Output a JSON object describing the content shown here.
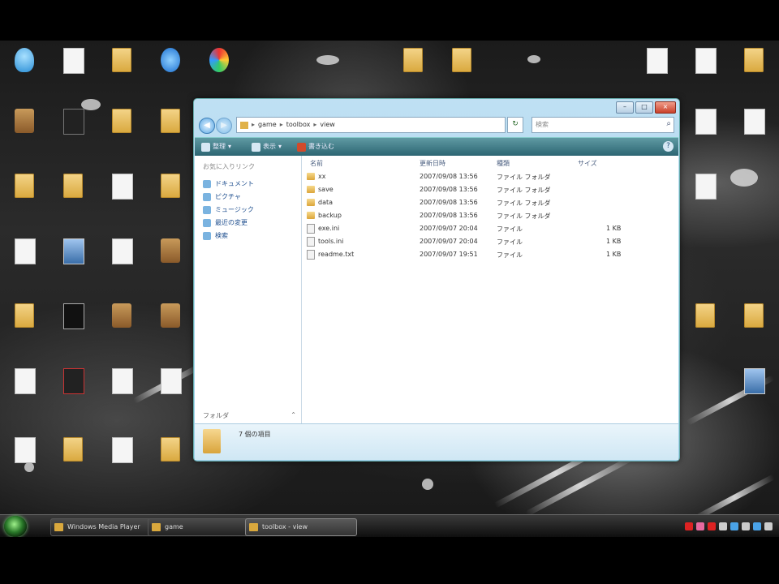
{
  "desktop": {
    "icons": [
      {
        "type": "user",
        "label": ""
      },
      {
        "type": "doc",
        "label": ""
      },
      {
        "type": "folder",
        "label": ""
      },
      {
        "type": "ie",
        "label": ""
      },
      {
        "type": "color",
        "label": ""
      },
      {
        "type": "box",
        "label": ""
      },
      {
        "type": "rss",
        "label": ""
      },
      {
        "type": "folder",
        "label": ""
      },
      {
        "type": "folder",
        "label": ""
      },
      {
        "type": "folder",
        "label": ""
      },
      {
        "type": "folder",
        "label": ""
      },
      {
        "type": "doc",
        "label": ""
      },
      {
        "type": "folder",
        "label": ""
      },
      {
        "type": "doc",
        "label": ""
      },
      {
        "type": "pic",
        "label": ""
      },
      {
        "type": "doc",
        "label": ""
      },
      {
        "type": "box",
        "label": ""
      },
      {
        "type": "folder",
        "label": ""
      },
      {
        "type": "dark",
        "label": ""
      },
      {
        "type": "box",
        "label": ""
      },
      {
        "type": "box",
        "label": ""
      },
      {
        "type": "doc",
        "label": ""
      },
      {
        "type": "red",
        "label": ""
      },
      {
        "type": "doc",
        "label": ""
      },
      {
        "type": "doc",
        "label": ""
      },
      {
        "type": "doc",
        "label": ""
      },
      {
        "type": "folder",
        "label": ""
      },
      {
        "type": "doc",
        "label": ""
      },
      {
        "type": "folder",
        "label": ""
      },
      {
        "type": "folder",
        "label": ""
      },
      {
        "type": "folder",
        "label": ""
      },
      {
        "type": "doc",
        "label": ""
      },
      {
        "type": "doc",
        "label": ""
      },
      {
        "type": "folder",
        "label": ""
      },
      {
        "type": "doc",
        "label": ""
      },
      {
        "type": "doc",
        "label": ""
      },
      {
        "type": "doc",
        "label": ""
      },
      {
        "type": "folder",
        "label": ""
      },
      {
        "type": "folder",
        "label": ""
      },
      {
        "type": "pic",
        "label": ""
      }
    ]
  },
  "window": {
    "title_buttons": {
      "minimize": "–",
      "maximize": "□",
      "close": "×"
    },
    "nav": {
      "back": "◀",
      "forward": "▶"
    },
    "address": {
      "crumbs": [
        "game",
        "toolbox",
        "view"
      ]
    },
    "search": {
      "placeholder": "検索"
    },
    "command_bar": {
      "organize": "整理",
      "views": "表示",
      "burn": "書き込む"
    },
    "nav_pane": {
      "header": "お気に入りリンク",
      "favorites": [
        "ドキュメント",
        "ピクチャ",
        "ミュージック",
        "最近の変更",
        "検索"
      ],
      "folders_label": "フォルダ"
    },
    "columns": {
      "name": "名前",
      "date": "更新日時",
      "type": "種類",
      "size": "サイズ"
    },
    "files": [
      {
        "kind": "folder",
        "name": "xx",
        "date": "2007/09/08 13:56",
        "type": "ファイル フォルダ",
        "size": ""
      },
      {
        "kind": "folder",
        "name": "save",
        "date": "2007/09/08 13:56",
        "type": "ファイル フォルダ",
        "size": ""
      },
      {
        "kind": "folder",
        "name": "data",
        "date": "2007/09/08 13:56",
        "type": "ファイル フォルダ",
        "size": ""
      },
      {
        "kind": "folder",
        "name": "backup",
        "date": "2007/09/08 13:56",
        "type": "ファイル フォルダ",
        "size": ""
      },
      {
        "kind": "file",
        "name": "exe.ini",
        "date": "2007/09/07 20:04",
        "type": "ファイル",
        "size": "1 KB"
      },
      {
        "kind": "file",
        "name": "tools.ini",
        "date": "2007/09/07 20:04",
        "type": "ファイル",
        "size": "1 KB"
      },
      {
        "kind": "file",
        "name": "readme.txt",
        "date": "2007/09/07 19:51",
        "type": "ファイル",
        "size": "1 KB"
      }
    ],
    "details": {
      "text": "7 個の項目"
    }
  },
  "taskbar": {
    "tasks": [
      {
        "label": "Windows Media Player"
      },
      {
        "label": "game"
      },
      {
        "label": "toolbox - view"
      }
    ],
    "clock": ""
  }
}
